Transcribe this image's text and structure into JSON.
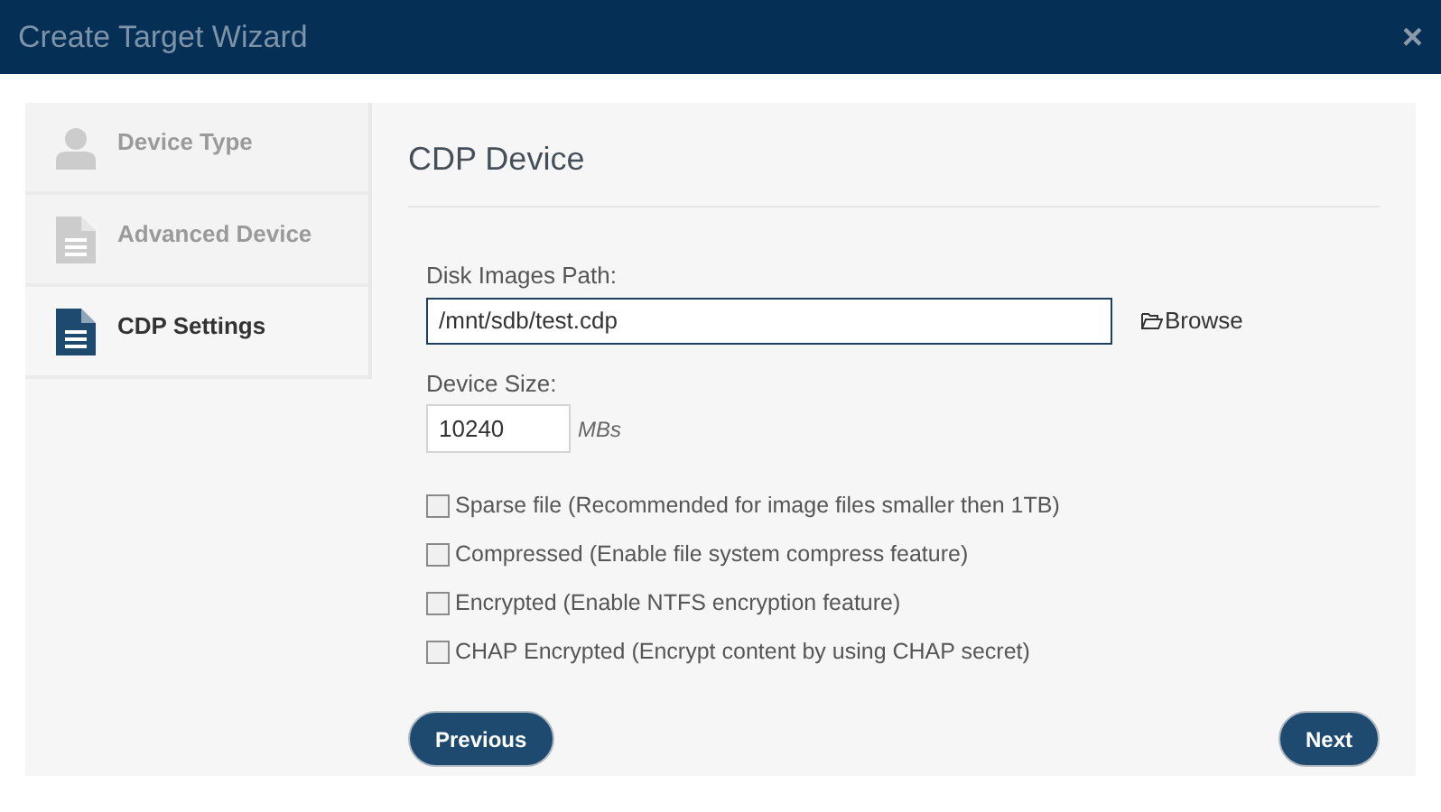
{
  "window": {
    "title": "Create Target Wizard",
    "close": "×"
  },
  "steps": [
    {
      "label": "Device Type",
      "kind": "person",
      "selected": false
    },
    {
      "label": "Advanced Device",
      "kind": "document",
      "selected": false
    },
    {
      "label": "CDP Settings",
      "kind": "document",
      "selected": true
    }
  ],
  "heading": "CDP Device",
  "path": {
    "label": "Disk Images Path:",
    "value": "/mnt/sdb/test.cdp",
    "browse": "Browse"
  },
  "size": {
    "label": "Device Size:",
    "value": "10240",
    "unit": "MBs"
  },
  "options": [
    {
      "label": "Sparse file (Recommended for image files smaller then 1TB)",
      "checked": false
    },
    {
      "label": "Compressed (Enable file system compress feature)",
      "checked": false
    },
    {
      "label": "Encrypted (Enable NTFS encryption feature)",
      "checked": false
    },
    {
      "label": "CHAP Encrypted (Encrypt content by using CHAP secret)",
      "checked": false
    }
  ],
  "buttons": {
    "previous": "Previous",
    "next": "Next"
  }
}
